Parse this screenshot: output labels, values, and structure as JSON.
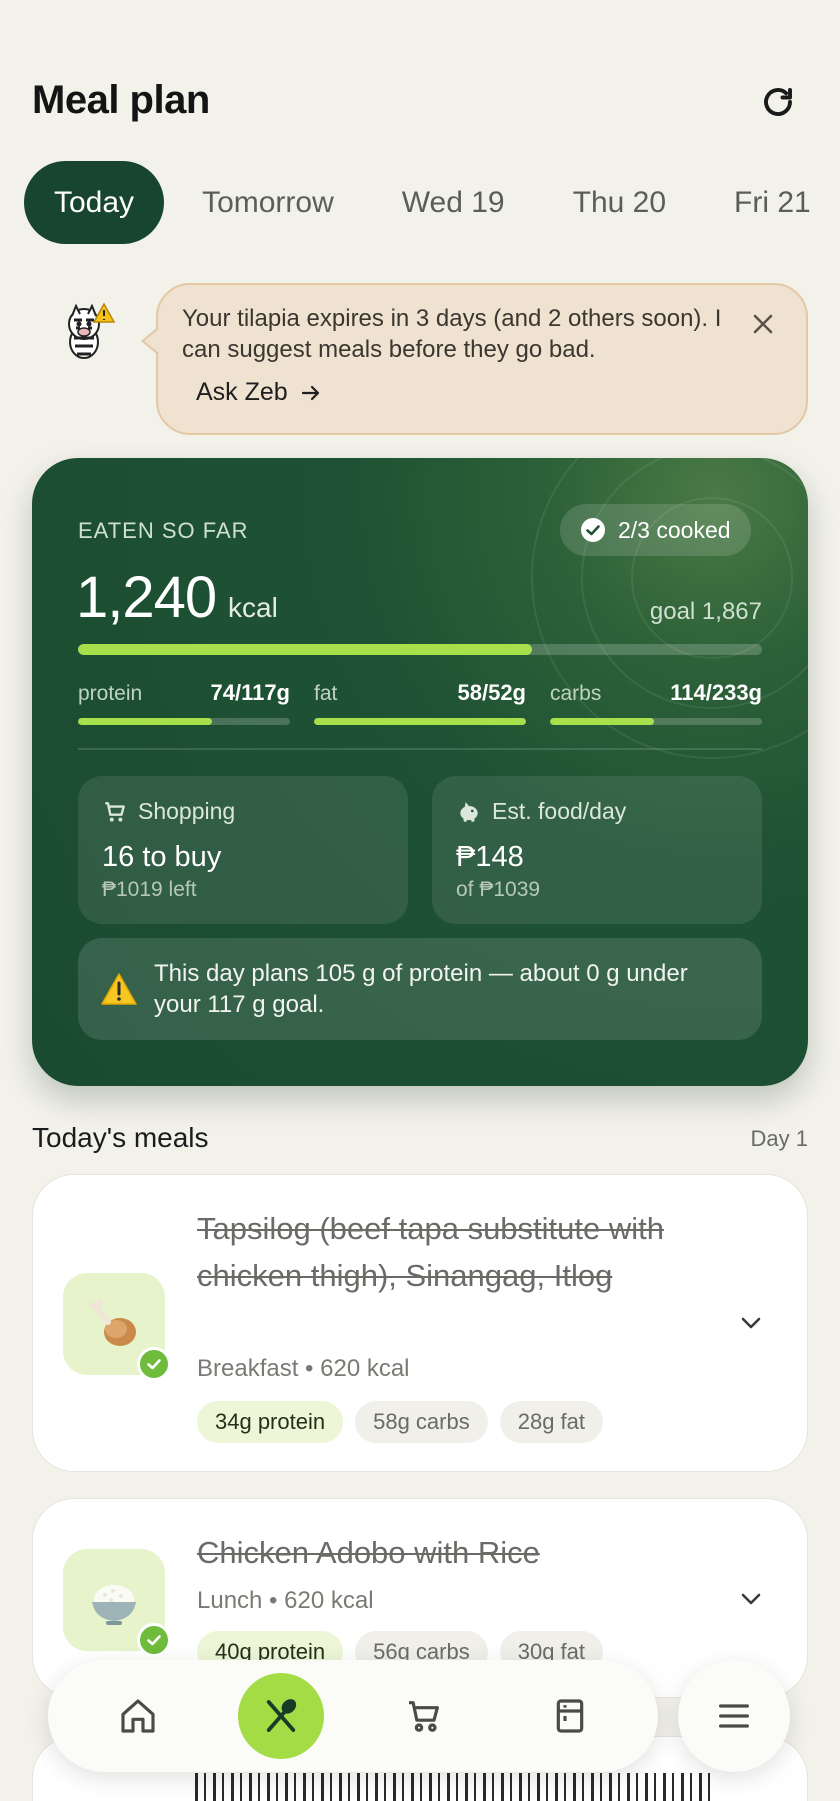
{
  "header": {
    "title": "Meal plan",
    "refresh_icon": "refresh-icon"
  },
  "tabs": [
    {
      "label": "Today",
      "active": true
    },
    {
      "label": "Tomorrow",
      "active": false
    },
    {
      "label": "Wed 19",
      "active": false
    },
    {
      "label": "Thu 20",
      "active": false
    },
    {
      "label": "Fri 21",
      "active": false
    }
  ],
  "alert": {
    "text": "Your tilapia expires in 3 days (and 2 others soon). I can suggest meals before they go bad.",
    "action_label": "Ask Zeb",
    "mascot_icon": "zebra-mascot-icon",
    "close_icon": "close-icon"
  },
  "summary": {
    "eaten_label": "EATEN SO FAR",
    "cooked_label": "2/3 cooked",
    "kcal_value": "1,240",
    "kcal_unit": "kcal",
    "goal_label": "goal 1,867",
    "kcal_progress": 0.664,
    "macros": [
      {
        "name": "protein",
        "value": "74/117g",
        "progress": 0.63
      },
      {
        "name": "fat",
        "value": "58/52g",
        "progress": 1.0
      },
      {
        "name": "carbs",
        "value": "114/233g",
        "progress": 0.49
      }
    ],
    "shopping": {
      "label": "Shopping",
      "value": "16 to buy",
      "sub": "₱1019 left",
      "icon": "cart-icon"
    },
    "food_per_day": {
      "label": "Est. food/day",
      "value": "₱148",
      "sub": "of ₱1039",
      "icon": "piggy-bank-icon"
    },
    "warning": {
      "text": "This day plans 105 g of protein — about 0 g under your 117 g goal.",
      "icon": "warning-icon"
    }
  },
  "meals_section": {
    "title": "Today's meals",
    "day_label": "Day 1"
  },
  "meals": [
    {
      "title": "Tapsilog (beef tapa substitute with chicken thigh), Sinangag, Itlog",
      "meta": "Breakfast • 620 kcal",
      "chips": [
        "34g protein",
        "58g carbs",
        "28g fat"
      ],
      "icon": "chicken-leg-icon",
      "done": true
    },
    {
      "title": "Chicken Adobo with Rice",
      "meta": "Lunch • 620 kcal",
      "chips": [
        "40g protein",
        "56g carbs",
        "30g fat"
      ],
      "icon": "rice-bowl-icon",
      "done": true
    }
  ],
  "nav": {
    "items": [
      "home-icon",
      "meals-icon",
      "cart-icon",
      "pantry-icon"
    ],
    "active": "meals-icon",
    "menu_icon": "menu-icon"
  },
  "colors": {
    "accent": "#a8e04c",
    "primary_dark": "#18452f",
    "background": "#f2f1ea",
    "alert_bg": "#f0e2d0"
  }
}
